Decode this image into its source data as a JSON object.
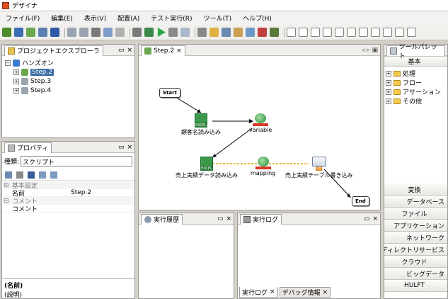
{
  "window": {
    "title": "デザイナ"
  },
  "menu": [
    "ファイル(F)",
    "編集(E)",
    "表示(V)",
    "配置(A)",
    "テスト実行(R)",
    "ツール(T)",
    "ヘルプ(H)"
  ],
  "explorer": {
    "title": "プロジェクトエクスプローラ",
    "root": "ハンズオン",
    "items": [
      "Step.2",
      "Step.3",
      "Step.4"
    ]
  },
  "properties": {
    "title": "プロパティ",
    "type_label": "種類:",
    "type_value": "スクリプト",
    "categories": [
      {
        "name": "基本設定",
        "rows": [
          {
            "key": "名前",
            "value": "Step.2"
          }
        ]
      },
      {
        "name": "コメント",
        "rows": [
          {
            "key": "コメント",
            "value": ""
          }
        ]
      }
    ],
    "footer_name": "(名前)",
    "footer_desc": "(説明)"
  },
  "editor": {
    "tab": "Step.2",
    "nodes": {
      "start": "Start",
      "read": "顧客名読み込み",
      "variable": "variable",
      "sales_read": "売上実績データ読み込み",
      "mapping": "mapping",
      "write": "売上実績テーブル書き込み",
      "end": "End"
    },
    "badges": {
      "excel": "EXCEL",
      "db": "DB"
    }
  },
  "history": {
    "title": "実行履歴"
  },
  "log": {
    "title": "実行ログ",
    "tabs": [
      "実行ログ",
      "デバッグ情報"
    ]
  },
  "palette": {
    "title": "ツールパレット",
    "section": "基本",
    "groups": [
      "処理",
      "フロー",
      "アサーション",
      "その他"
    ],
    "categories": [
      "変換",
      "データベース",
      "ファイル",
      "アプリケーション",
      "ネットワーク",
      "ディレクトリサービス",
      "クラウド",
      "ビッグデータ",
      "HULFT"
    ]
  },
  "controls": {
    "close": "×",
    "min": "▭",
    "nav": "◃ ▹ ▣"
  }
}
